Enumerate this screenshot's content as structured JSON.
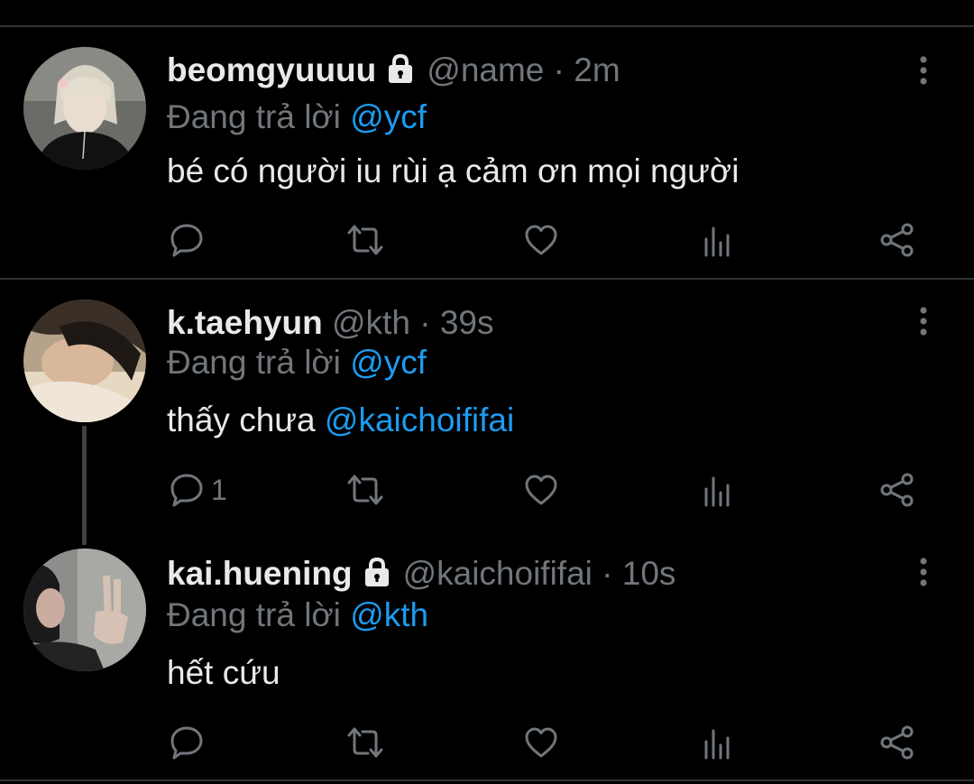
{
  "tweets": [
    {
      "display_name": "beomgyuuuu",
      "protected": true,
      "handle": "@name",
      "separator": " · ",
      "time": "2m",
      "reply_prefix": "Đang trả lời ",
      "reply_to": "@ycf",
      "text": "bé có người iu rùi ạ cảm ơn mọi người",
      "mention_in_text": "",
      "reply_count": ""
    },
    {
      "display_name": "k.taehyun",
      "protected": false,
      "handle": "@kth",
      "separator": " · ",
      "time": "39s",
      "reply_prefix": "Đang trả lời ",
      "reply_to": "@ycf",
      "text": "thấy chưa ",
      "mention_in_text": "@kaichoififai",
      "reply_count": "1"
    },
    {
      "display_name": "kai.huening",
      "protected": true,
      "handle": "@kaichoififai",
      "separator": " · ",
      "time": "10s",
      "reply_prefix": "Đang trả lời ",
      "reply_to": "@kth",
      "text": "hết cứu",
      "mention_in_text": "",
      "reply_count": ""
    }
  ],
  "icons": {
    "lock": "lock-icon",
    "more": "more-vertical-icon",
    "reply": "reply-icon",
    "retweet": "retweet-icon",
    "like": "heart-icon",
    "views": "views-icon",
    "share": "share-icon"
  },
  "colors": {
    "background": "#000000",
    "text": "#e7e9ea",
    "secondary": "#71767b",
    "link": "#1d9bf0",
    "divider": "#2f3336"
  }
}
